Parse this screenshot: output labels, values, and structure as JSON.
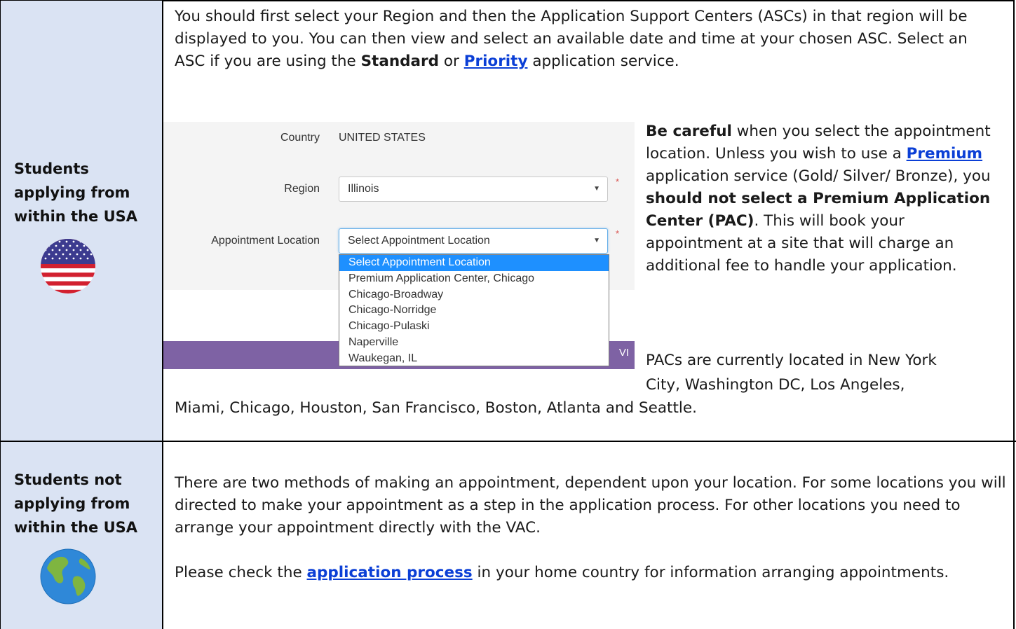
{
  "rows": [
    {
      "label": "Students applying from within the USA",
      "icon": "us-flag-icon",
      "intro": {
        "text1": "You should first select your Region and then the Application Support Centers (ASCs) in that region will be displayed to you. You can then view and select an available date and time at your chosen ASC. Select an ASC if you are using the ",
        "bold1": "Standard",
        "text2": " or ",
        "link1": "Priority",
        "text3": " application service."
      },
      "form": {
        "country_label": "Country",
        "country_value": "UNITED STATES",
        "region_label": "Region",
        "region_value": "Illinois",
        "location_label": "Appointment Location",
        "location_value": "Select Appointment Location",
        "required_mark": "*",
        "dropdown_options": [
          "Select Appointment Location",
          "Premium Application Center, Chicago",
          "Chicago-Broadway",
          "Chicago-Norridge",
          "Chicago-Pulaski",
          "Naperville",
          "Waukegan, IL"
        ],
        "footer_text": "VI"
      },
      "warning": {
        "bold1": "Be careful",
        "text1": " when you select the appointment location. Unless you wish to use a ",
        "link1": "Premium",
        "text2": " application service (Gold/ Silver/ Bronze), you ",
        "bold2": "should not select a Premium Application Center (PAC)",
        "text3": ". This will book your appointment at a site that will charge an additional fee to handle your application."
      },
      "pac_line1": "PACs are currently located in New York",
      "pac_line2": "City, Washington DC, Los Angeles,",
      "pac_line3": "Miami, Chicago, Houston, San Francisco, Boston, Atlanta and Seattle."
    },
    {
      "label": "Students not applying from within the USA",
      "icon": "globe-icon",
      "para1": "There are two methods of making an appointment, dependent upon your location. For some locations you will directed to make your appointment as a step in the application process. For other locations you need to arrange your appointment directly with the VAC.",
      "para2": {
        "text1": "Please check the ",
        "link1": "application process",
        "text2": " in your home country for information arranging appointments."
      }
    }
  ],
  "colors": {
    "left_column": "#dae3f3",
    "link": "#0b3fd6",
    "footer_bar": "#7e62a4",
    "dropdown_highlight": "#1e90ff"
  }
}
